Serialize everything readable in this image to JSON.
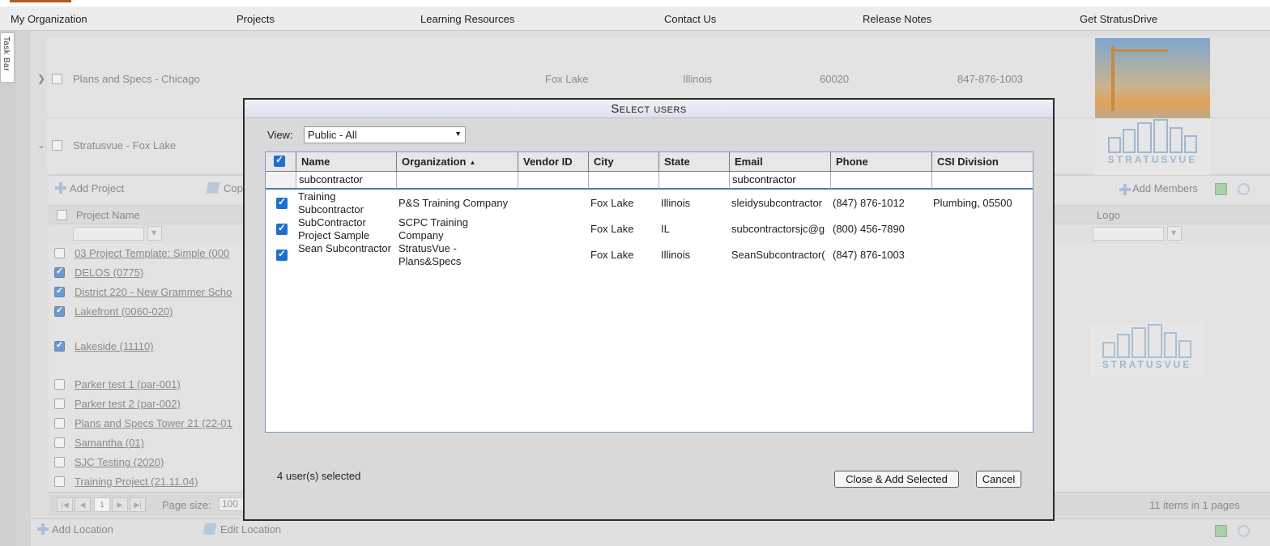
{
  "nav": {
    "items": [
      {
        "label": "My Organization"
      },
      {
        "label": "Projects"
      },
      {
        "label": "Learning Resources"
      },
      {
        "label": "Contact Us"
      },
      {
        "label": "Release Notes"
      },
      {
        "label": "Get StratusDrive"
      }
    ]
  },
  "taskbar": {
    "label": "Task Bar"
  },
  "background": {
    "locations": [
      {
        "name": "Plans and Specs - Chicago",
        "city": "Fox Lake",
        "state": "Illinois",
        "zip": "60020",
        "phone": "847-876-1003"
      },
      {
        "name": "Stratusvue - Fox Lake"
      }
    ],
    "logo_text": "STRATUSVUE",
    "toolbar": {
      "add_project": "Add Project",
      "copy": "Cop",
      "add_members": "Add Members"
    },
    "columns": {
      "project_name": "Project Name",
      "logo": "Logo"
    },
    "projects": [
      {
        "name": "03 Project Template: Simple (000",
        "checked": false
      },
      {
        "name": "DELOS (0775)",
        "checked": true
      },
      {
        "name": "District 220 - New Grammer Scho",
        "checked": true
      },
      {
        "name": "Lakefront (0060-020)",
        "checked": true
      },
      {
        "name": "Lakeside (11110)",
        "checked": true
      },
      {
        "name": "Parker test 1 (par-001)",
        "checked": false
      },
      {
        "name": "Parker test 2 (par-002)",
        "checked": false
      },
      {
        "name": "Plans and Specs Tower 21 (22-01",
        "checked": false
      },
      {
        "name": "Samantha (01)",
        "checked": false
      },
      {
        "name": "SJC Testing (2020)",
        "checked": false
      },
      {
        "name": "Training Project (21.11.04)",
        "checked": false
      }
    ],
    "pager": {
      "page": "1",
      "page_size_label": "Page size:",
      "page_size": "100",
      "summary": "11 items in 1 pages"
    },
    "bottom": {
      "add_location": "Add Location",
      "edit_location": "Edit Location"
    }
  },
  "dialog": {
    "title": "Select users",
    "view_label": "View:",
    "view_value": "Public - All",
    "columns": [
      "Name",
      "Organization",
      "Vendor ID",
      "City",
      "State",
      "Email",
      "Phone",
      "CSI Division"
    ],
    "filters": {
      "name": "subcontractor",
      "email": "subcontractor"
    },
    "rows": [
      {
        "name": "Training Subcontractor",
        "organization": "P&S Training Company",
        "vendor_id": "",
        "city": "Fox Lake",
        "state": "Illinois",
        "email": "sleidysubcontractor",
        "phone": "(847) 876-1012",
        "csi": "Plumbing, 05500",
        "checked": true
      },
      {
        "name": "SubContractor Project Sample",
        "organization": "SCPC Training Company",
        "vendor_id": "",
        "city": "Fox Lake",
        "state": "IL",
        "email": "subcontractorsjc@g",
        "phone": "(800) 456-7890",
        "csi": "",
        "checked": true
      },
      {
        "name": "Sean Subcontractor",
        "organization": "StratusVue - Plans&Specs",
        "vendor_id": "",
        "city": "Fox Lake",
        "state": "Illinois",
        "email": "SeanSubcontractor(",
        "phone": "(847) 876-1003",
        "csi": "",
        "checked": true
      }
    ],
    "selected_count": "4 user(s) selected",
    "buttons": {
      "close_add": "Close & Add Selected",
      "cancel": "Cancel"
    }
  }
}
